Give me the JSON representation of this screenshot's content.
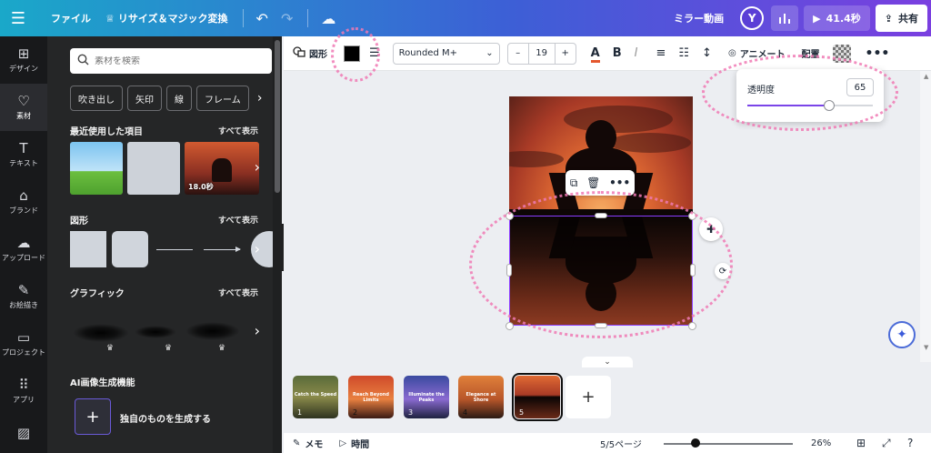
{
  "topbar": {
    "file": "ファイル",
    "resize": "リサイズ＆マジック変換",
    "mirror": "ミラー動画",
    "avatar": "Y",
    "play": "41.4秒",
    "share": "共有"
  },
  "rail": {
    "items": [
      {
        "label": "デザイン",
        "icon": "⊞"
      },
      {
        "label": "素材",
        "icon": "♡"
      },
      {
        "label": "テキスト",
        "icon": "T"
      },
      {
        "label": "ブランド",
        "icon": "⌂"
      },
      {
        "label": "アップロード",
        "icon": "☁"
      },
      {
        "label": "お絵描き",
        "icon": "✎"
      },
      {
        "label": "プロジェクト",
        "icon": "▭"
      },
      {
        "label": "アプリ",
        "icon": "⠿"
      }
    ]
  },
  "panel": {
    "search_placeholder": "素材を検索",
    "chips": [
      "吹き出し",
      "矢印",
      "線",
      "フレーム"
    ],
    "recent_title": "最近使用した項目",
    "see_all": "すべて表示",
    "recent_badge": "18.0秒",
    "shapes_title": "図形",
    "graphics_title": "グラフィック",
    "ai_title": "AI画像生成機能",
    "ai_generate": "独自のものを生成する"
  },
  "toolbar": {
    "shape": "図形",
    "font": "Rounded M+",
    "font_size": "19",
    "animate": "アニメート",
    "arrange": "配置"
  },
  "transparency": {
    "label": "透明度",
    "value": "65",
    "fraction": 0.65
  },
  "filmstrip": {
    "pages": [
      {
        "num": "1",
        "caption": "Catch the Speed"
      },
      {
        "num": "2",
        "caption": "Reach Beyond Limits"
      },
      {
        "num": "3",
        "caption": "Illuminate the Peaks"
      },
      {
        "num": "4",
        "caption": "Elegance at Shore"
      },
      {
        "num": "5",
        "caption": ""
      }
    ]
  },
  "bottombar": {
    "memo": "メモ",
    "time": "時間",
    "pages": "5/5ページ",
    "zoom": "26%"
  },
  "colors": {
    "accent": "#8b3dff",
    "annotation": "#f07ab4"
  }
}
